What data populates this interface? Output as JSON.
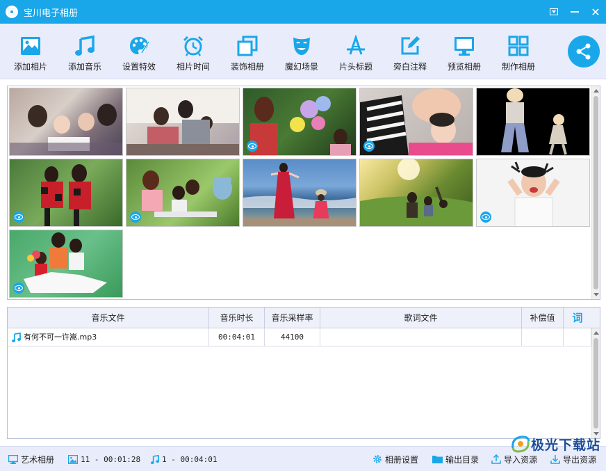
{
  "window": {
    "title": "宝川电子相册"
  },
  "toolbar": {
    "items": [
      {
        "label": "添加相片",
        "icon": "add-photo-icon"
      },
      {
        "label": "添加音乐",
        "icon": "music-note-icon"
      },
      {
        "label": "设置特效",
        "icon": "palette-icon"
      },
      {
        "label": "相片时间",
        "icon": "alarm-clock-icon"
      },
      {
        "label": "装饰相册",
        "icon": "decorate-icon"
      },
      {
        "label": "魔幻场景",
        "icon": "theater-mask-icon"
      },
      {
        "label": "片头标题",
        "icon": "title-icon"
      },
      {
        "label": "旁白注释",
        "icon": "edit-note-icon"
      },
      {
        "label": "预览相册",
        "icon": "monitor-icon"
      },
      {
        "label": "制作相册",
        "icon": "grid-icon"
      }
    ],
    "share_icon": "share-icon"
  },
  "photos": {
    "count": 11,
    "items": [
      {
        "name": "family-reading",
        "has_eye": false
      },
      {
        "name": "family-sofa",
        "has_eye": false
      },
      {
        "name": "balloons",
        "has_eye": true
      },
      {
        "name": "mother-child",
        "has_eye": true
      },
      {
        "name": "cartoon-dance",
        "has_eye": false
      },
      {
        "name": "red-dress-girls",
        "has_eye": true
      },
      {
        "name": "outdoor-table",
        "has_eye": true
      },
      {
        "name": "beach-walk",
        "has_eye": false
      },
      {
        "name": "sunset-field",
        "has_eye": false
      },
      {
        "name": "surprised-man",
        "has_eye": true
      },
      {
        "name": "family-green",
        "has_eye": true
      }
    ]
  },
  "music_table": {
    "columns": [
      "音乐文件",
      "音乐时长",
      "音乐采样率",
      "歌词文件",
      "补偿值",
      "词"
    ],
    "rows": [
      {
        "file": "有何不可一许嵩.mp3",
        "duration": "00:04:01",
        "sample_rate": "44100",
        "lyrics": "",
        "offset": "",
        "extra": ""
      }
    ]
  },
  "statusbar": {
    "art_album": "艺术相册",
    "photo_summary": "11 - 00:01:28",
    "music_summary": "1 - 00:04:01",
    "album_settings": "相册设置",
    "output_dir": "输出目录",
    "import_res": "导入资源",
    "export_res": "导出资源"
  },
  "watermark": {
    "text": "极光下载站"
  },
  "colors": {
    "accent": "#1aa7ea",
    "toolbar_bg": "#e9ecfb"
  }
}
